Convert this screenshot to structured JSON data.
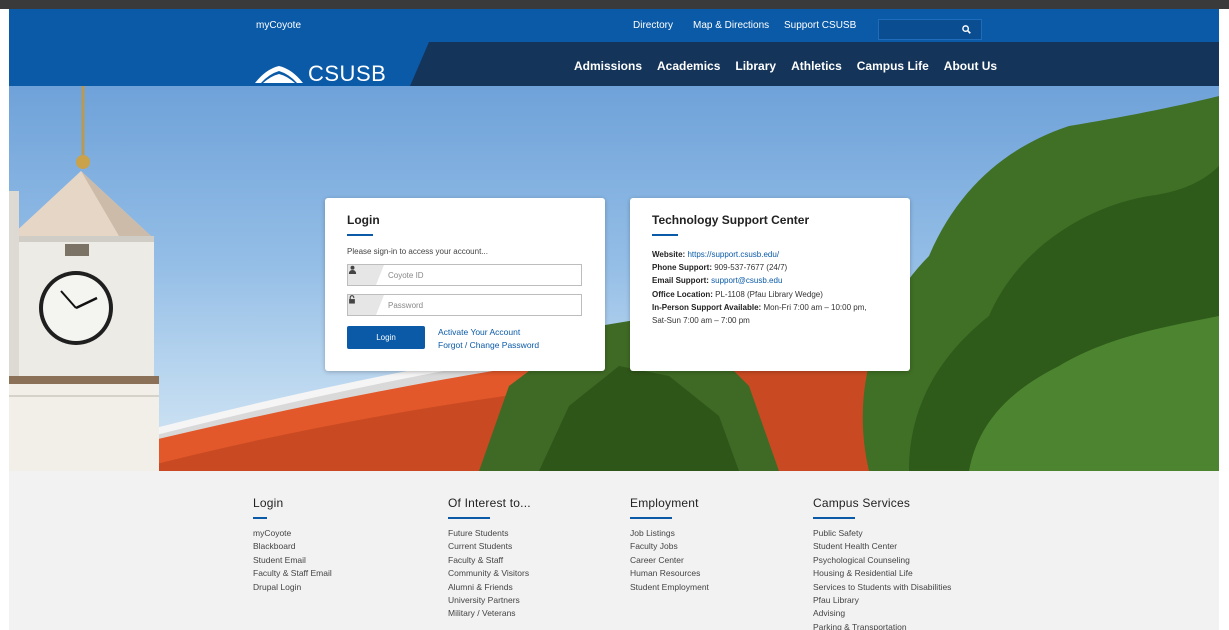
{
  "utility": {
    "mycoyote": "myCoyote",
    "directory": "Directory",
    "map_directions": "Map & Directions",
    "support": "Support CSUSB",
    "search_placeholder": "",
    "search_icon": "search-icon"
  },
  "brand": {
    "logo_text": "CSUSB",
    "logo_icon": "mountain-logo-icon",
    "primary_color": "#0a5aa8",
    "nav_color": "#143459"
  },
  "nav": {
    "items": [
      "Admissions",
      "Academics",
      "Library",
      "Athletics",
      "Campus Life",
      "About Us"
    ]
  },
  "login": {
    "title": "Login",
    "hint": "Please sign-in to access your account...",
    "username_placeholder": "Coyote ID",
    "username_icon": "user-icon",
    "password_placeholder": "Password",
    "password_icon": "lock-icon",
    "button": "Login",
    "activate_link": "Activate Your Account",
    "forgot_link": "Forgot / Change Password"
  },
  "support": {
    "title": "Technology Support Center",
    "website_label": "Website:",
    "website_value": "https://support.csusb.edu/",
    "phone_label": "Phone Support:",
    "phone_value": "909-537-7677 (24/7)",
    "email_label": "Email Support:",
    "email_value": "support@csusb.edu",
    "office_label": "Office Location:",
    "office_value": "PL-1108 (Pfau Library Wedge)",
    "inperson_label": "In-Person Support Available:",
    "inperson_value": "Mon-Fri 7:00 am – 10:00 pm,",
    "inperson_value2": "Sat-Sun 7:00 am – 7:00 pm"
  },
  "footer": {
    "columns": [
      {
        "title": "Login",
        "items": [
          "myCoyote",
          "Blackboard",
          "Student Email",
          "Faculty & Staff Email",
          "Drupal Login"
        ]
      },
      {
        "title": "Of Interest to...",
        "items": [
          "Future Students",
          "Current Students",
          "Faculty & Staff",
          "Community & Visitors",
          "Alumni & Friends",
          "University Partners",
          "Military / Veterans"
        ]
      },
      {
        "title": "Employment",
        "items": [
          "Job Listings",
          "Faculty Jobs",
          "Career Center",
          "Human Resources",
          "Student Employment"
        ]
      },
      {
        "title": "Campus Services",
        "items": [
          "Public Safety",
          "Student Health Center",
          "Psychological Counseling",
          "Housing & Residential Life",
          "Services to Students with Disabilities",
          "Pfau Library",
          "Advising",
          "Parking & Transportation"
        ]
      }
    ]
  }
}
